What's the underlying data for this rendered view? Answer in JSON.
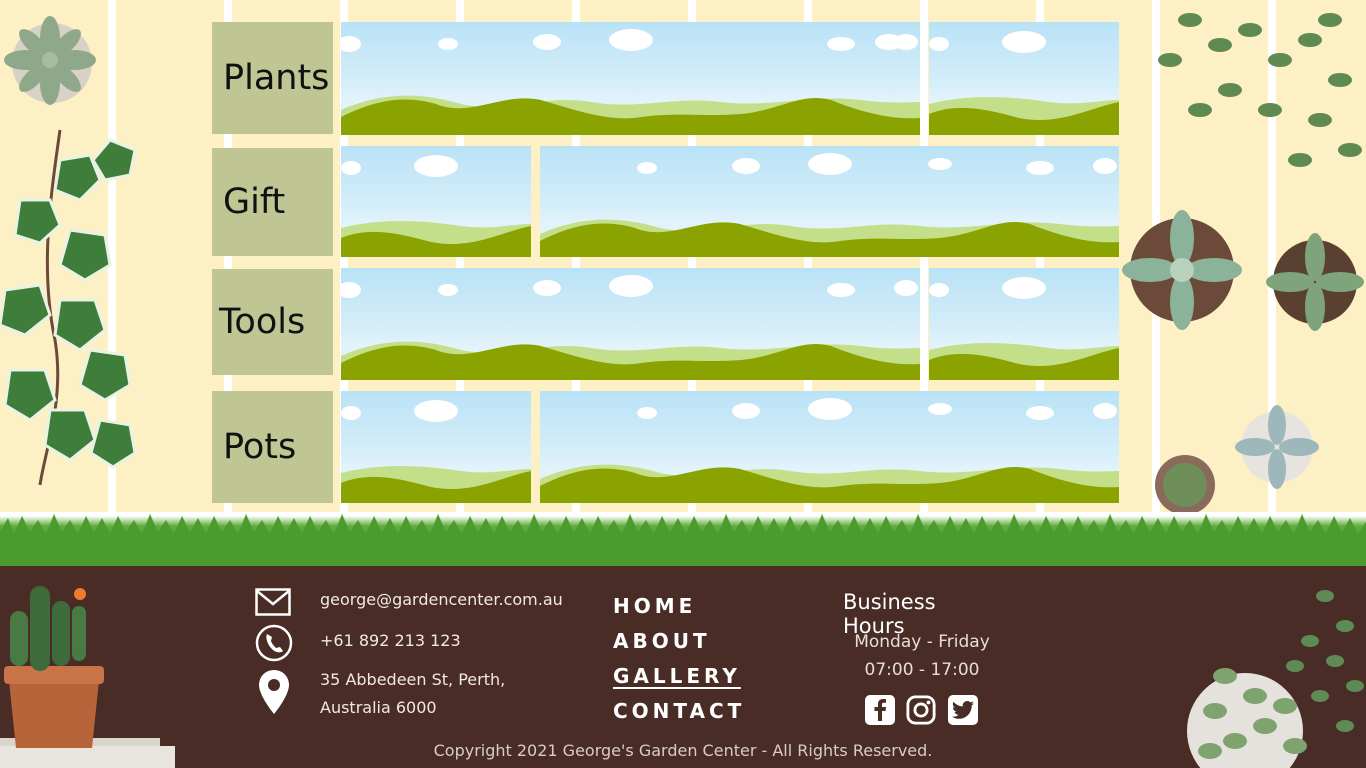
{
  "categories": [
    {
      "label": "Plants"
    },
    {
      "label": "Gift"
    },
    {
      "label": "Tools"
    },
    {
      "label": "Pots"
    }
  ],
  "footer": {
    "email": "george@gardencenter.com.au",
    "phone": "+61 892 213 123",
    "address_line1": "35 Abbedeen St, Perth,",
    "address_line2": "Australia 6000",
    "nav": {
      "home": "HOME",
      "about": "ABOUT",
      "gallery": "GALLERY",
      "contact": "CONTACT"
    },
    "active_nav": "GALLERY",
    "hours": {
      "title": "Business Hours",
      "days": "Monday - Friday",
      "time": "07:00 - 17:00"
    },
    "social": [
      "facebook-icon",
      "instagram-icon",
      "twitter-icon"
    ],
    "copyright": "Copyright 2021 George's Garden Center - All Rights Reserved."
  },
  "colors": {
    "background": "#fdf0c4",
    "category_bg": "#bfc693",
    "footer_bg": "#4a2c26",
    "hill_dark": "#8aa300",
    "hill_light": "#c4df8a"
  }
}
